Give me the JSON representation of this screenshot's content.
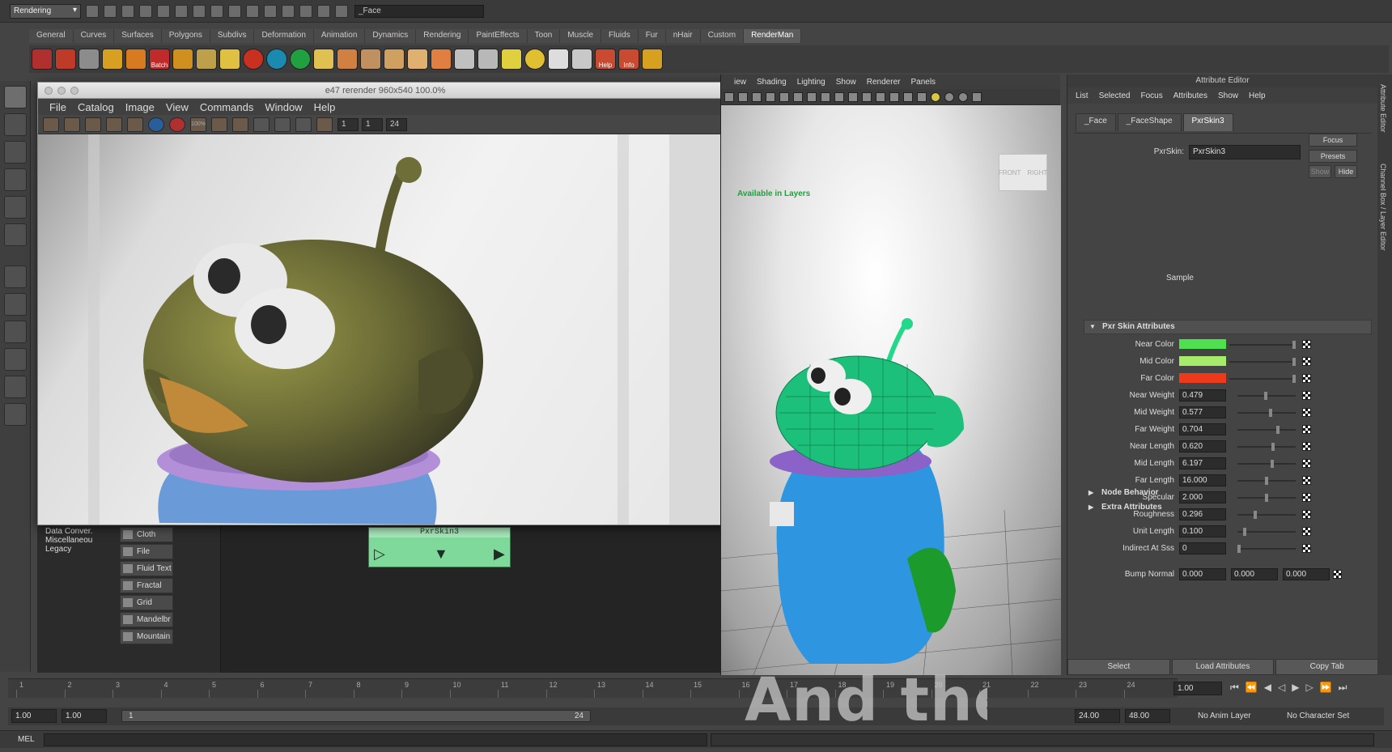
{
  "topbar": {
    "mode": "Rendering",
    "name_field": "_Face"
  },
  "shelf_tabs": [
    "General",
    "Curves",
    "Surfaces",
    "Polygons",
    "Subdivs",
    "Deformation",
    "Animation",
    "Dynamics",
    "Rendering",
    "PaintEffects",
    "Toon",
    "Muscle",
    "Fluids",
    "Fur",
    "nHair",
    "Custom",
    "RenderMan"
  ],
  "active_shelf_tab": "RenderMan",
  "shelf_labels": {
    "batch": "Batch",
    "help": "Help",
    "info": "Info"
  },
  "render_view": {
    "title": "e47 rerender 960x540 100.0%",
    "menu": [
      "File",
      "Catalog",
      "Image",
      "View",
      "Commands",
      "Window",
      "Help"
    ],
    "zoom": "100%",
    "frames": [
      "1",
      "1",
      "24"
    ]
  },
  "hypershade": {
    "categories": [
      "Data Conver.",
      "Miscellaneou",
      "Legacy"
    ],
    "textures": [
      "Cloth",
      "File",
      "Fluid Text",
      "Fractal",
      "Grid",
      "Mandelbr",
      "Mountain"
    ],
    "node_title": "PxrSkin3"
  },
  "viewport": {
    "menu": [
      "iew",
      "Shading",
      "Lighting",
      "Show",
      "Renderer",
      "Panels"
    ],
    "cube_front": "FRONT",
    "cube_right": "RIGHT",
    "available_text": "Available in Layers"
  },
  "attr_editor": {
    "title": "Attribute Editor",
    "menu": [
      "List",
      "Selected",
      "Focus",
      "Attributes",
      "Show",
      "Help"
    ],
    "tabs": [
      "_Face",
      "_FaceShape",
      "PxrSkin3"
    ],
    "active_tab": "PxrSkin3",
    "node_label": "PxrSkin:",
    "node_value": "PxrSkin3",
    "focus_btn": "Focus",
    "presets_btn": "Presets",
    "show_btn": "Show",
    "hide_btn": "Hide",
    "sample_label": "Sample",
    "section_title": "Pxr Skin Attributes",
    "colors": [
      {
        "label": "Near Color",
        "color": "#4fe04f"
      },
      {
        "label": "Mid Color",
        "color": "#a6ec6a"
      },
      {
        "label": "Far Color",
        "color": "#ee3a1a"
      }
    ],
    "values": [
      {
        "label": "Near Weight",
        "value": "0.479",
        "slider": 0.479
      },
      {
        "label": "Mid Weight",
        "value": "0.577",
        "slider": 0.577
      },
      {
        "label": "Far Weight",
        "value": "0.704",
        "slider": 0.704
      },
      {
        "label": "Near Length",
        "value": "0.620",
        "slider": 0.62
      },
      {
        "label": "Mid Length",
        "value": "6.197",
        "slider": 0.6
      },
      {
        "label": "Far Length",
        "value": "16.000",
        "slider": 0.5
      },
      {
        "label": "Specular",
        "value": "2.000",
        "slider": 0.5
      },
      {
        "label": "Roughness",
        "value": "0.296",
        "slider": 0.296
      },
      {
        "label": "Unit Length",
        "value": "0.100",
        "slider": 0.1
      },
      {
        "label": "Indirect At Sss",
        "value": "0",
        "slider": 0.0
      }
    ],
    "bump_label": "Bump Normal",
    "bump_values": [
      "0.000",
      "0.000",
      "0.000"
    ],
    "collapsed": [
      "Node Behavior",
      "Extra Attributes"
    ],
    "buttons": [
      "Select",
      "Load Attributes",
      "Copy Tab"
    ]
  },
  "side_tabs": [
    "Attribute Editor",
    "Channel Box / Layer Editor"
  ],
  "timeline": {
    "ticks": [
      "1",
      "2",
      "3",
      "4",
      "5",
      "6",
      "7",
      "8",
      "9",
      "10",
      "11",
      "12",
      "13",
      "14",
      "15",
      "16",
      "17",
      "18",
      "19",
      "20",
      "21",
      "22",
      "23",
      "24"
    ],
    "current_frame": "1.00"
  },
  "range": {
    "start": "1.00",
    "playback_start": "1.00",
    "slider_start": "1",
    "slider_end": "24",
    "playback_end": "24.00",
    "end": "48.00",
    "anim_layer": "No Anim Layer",
    "character_set": "No Character Set"
  },
  "mel_label": "MEL",
  "caption": "And then re"
}
